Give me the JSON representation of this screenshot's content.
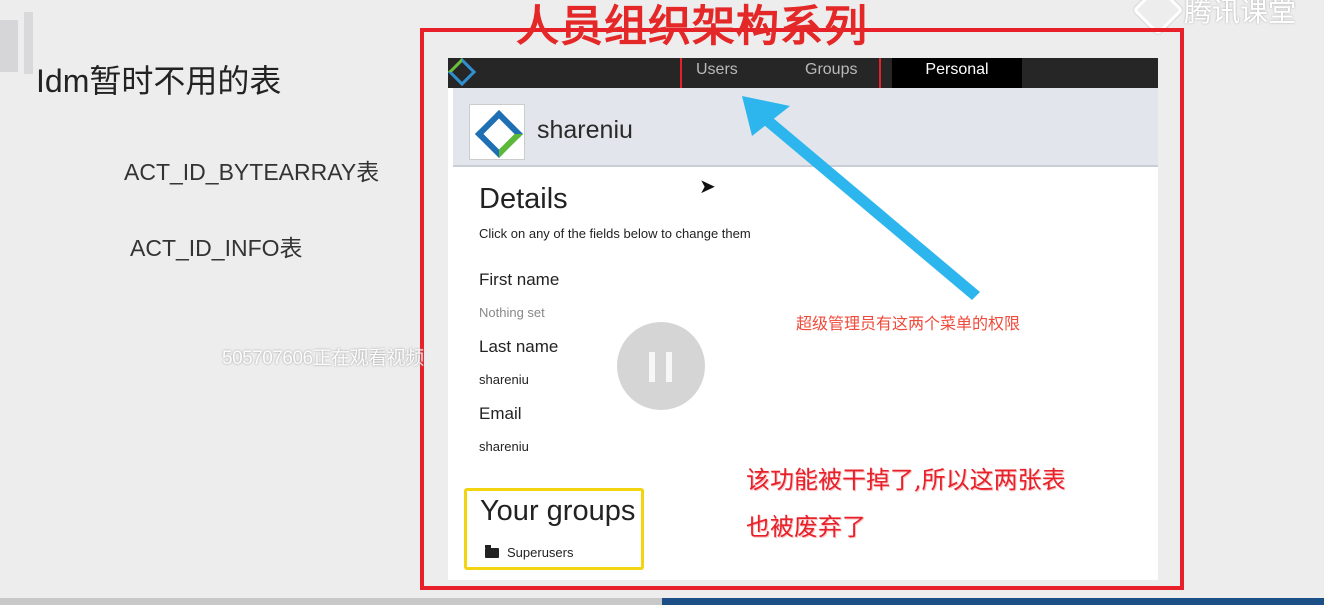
{
  "slide": {
    "title": "Idm暂时不用的表",
    "tables": [
      "ACT_ID_BYTEARRAY表",
      "ACT_ID_INFO表"
    ],
    "watermark": "505707606正在观看视频",
    "brand": "腾讯课堂"
  },
  "overlay_title": "人员组织架构系列",
  "app": {
    "nav": {
      "users": "Users",
      "groups": "Groups",
      "personal": "Personal"
    },
    "profile_name": "shareniu",
    "details": {
      "title": "Details",
      "subtitle": "Click on any of the fields below to change them",
      "fields": [
        {
          "label": "First name",
          "value": "Nothing set"
        },
        {
          "label": "Last name",
          "value": "shareniu"
        },
        {
          "label": "Email",
          "value": "shareniu"
        }
      ]
    },
    "groups": {
      "title": "Your groups",
      "item": "Superusers"
    }
  },
  "annotations": {
    "orange": "超级管理员有这两个菜单的权限",
    "red_line1": "该功能被干掉了,所以这两张表",
    "red_line2": "也被废弃了"
  },
  "colors": {
    "frame": "#e8202a",
    "arrow": "#2db6ee",
    "highlight_yellow": "#f2d410"
  },
  "icons": [
    "play-pause-icon",
    "folder-icon",
    "cursor-icon",
    "activiti-logo-icon",
    "tencent-classroom-logo-icon"
  ]
}
